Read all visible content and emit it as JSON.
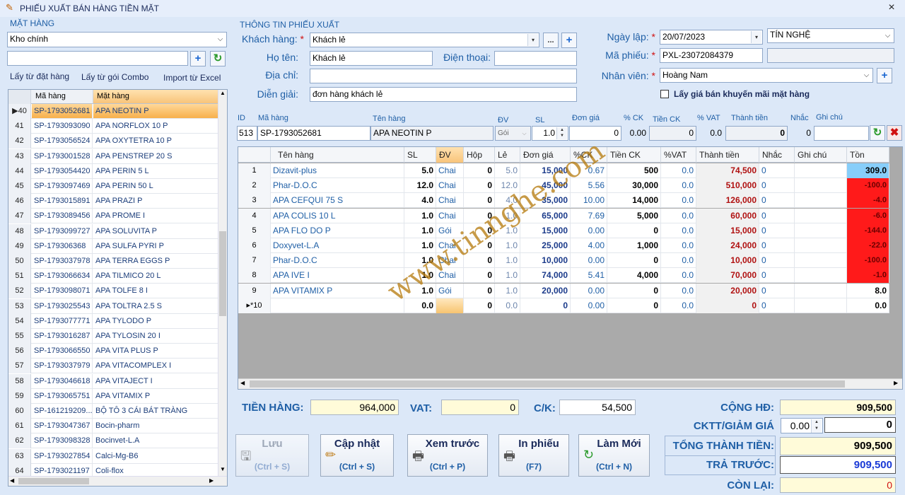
{
  "window": {
    "title": "PHIẾU XUẤT BÁN HÀNG TIỀN MẶT",
    "close": "×"
  },
  "left": {
    "group_title": "MẶT HÀNG",
    "warehouse": "Kho chính",
    "search_value": "",
    "links": [
      "Lấy từ đặt hàng",
      "Lấy từ gói Combo",
      "Import từ Excel"
    ],
    "columns": [
      "Mã hàng",
      "Mặt hàng"
    ],
    "rows": [
      [
        "▶40",
        "SP-1793052681",
        "APA NEOTIN P"
      ],
      [
        "41",
        "SP-1793093090",
        "APA NORFLOX 10 P"
      ],
      [
        "42",
        "SP-1793056524",
        "APA OXYTETRA 10 P"
      ],
      [
        "43",
        "SP-1793001528",
        "APA PENSTREP 20 S"
      ],
      [
        "44",
        "SP-1793054420",
        "APA PERIN 5 L"
      ],
      [
        "45",
        "SP-1793097469",
        "APA PERIN 50 L"
      ],
      [
        "46",
        "SP-1793015891",
        "APA PRAZI P"
      ],
      [
        "47",
        "SP-1793089456",
        "APA PROME I"
      ],
      [
        "48",
        "SP-1793099727",
        "APA SOLUVITA P"
      ],
      [
        "49",
        "SP-179306368",
        "APA SULFA PYRI P"
      ],
      [
        "50",
        "SP-1793037978",
        "APA TERRA EGGS P"
      ],
      [
        "51",
        "SP-1793066634",
        "APA TILMICO 20 L"
      ],
      [
        "52",
        "SP-1793098071",
        "APA TOLFE 8 I"
      ],
      [
        "53",
        "SP-1793025543",
        "APA TOLTRA 2.5 S"
      ],
      [
        "54",
        "SP-1793077771",
        "APA TYLODO P"
      ],
      [
        "55",
        "SP-1793016287",
        "APA TYLOSIN 20 I"
      ],
      [
        "56",
        "SP-1793066550",
        "APA VITA PLUS P"
      ],
      [
        "57",
        "SP-1793037979",
        "APA VITACOMPLEX I"
      ],
      [
        "58",
        "SP-1793046618",
        "APA VITAJECT I"
      ],
      [
        "59",
        "SP-1793065751",
        "APA VITAMIX P"
      ],
      [
        "60",
        "SP-161219209...",
        "BỘ TÔ 3 CÁI BÁT TRÀNG"
      ],
      [
        "61",
        "SP-1793047367",
        "Bocin-pharm"
      ],
      [
        "62",
        "SP-1793098328",
        "Bocinvet-L.A"
      ],
      [
        "63",
        "SP-1793027854",
        "Calci-Mg-B6"
      ],
      [
        "64",
        "SP-1793021197",
        "Coli-flox"
      ]
    ]
  },
  "info": {
    "group_title": "THÔNG TIN PHIẾU XUẤT",
    "customer_label": "Khách hàng:",
    "customer": "Khách lẻ",
    "ellipsis": "...",
    "name_label": "Họ tên:",
    "name": "Khách lẻ",
    "phone_label": "Điện thoại:",
    "phone": "",
    "address_label": "Địa chỉ:",
    "address": "",
    "note_label": "Diễn giải:",
    "note": "đơn hàng khách lẻ",
    "date_label": "Ngày lập:",
    "date": "20/07/2023",
    "store": "TÍN NGHỆ",
    "code_label": "Mã phiếu:",
    "code": "PXL-23072084379",
    "staff_label": "Nhân viên:",
    "staff": "Hoàng Nam",
    "promo_label": "Lấy giá bán khuyến mãi mặt hàng",
    "required": "*"
  },
  "entry": {
    "labels": {
      "id": "ID",
      "code": "Mã hàng",
      "name": "Tên hàng",
      "unit": "ĐV",
      "qty": "SL",
      "price": "Đơn giá",
      "pct_ck": "% CK",
      "ck": "Tiền CK",
      "vat": "% VAT",
      "total": "Thành tiền",
      "remind": "Nhắc",
      "note": "Ghi chú"
    },
    "values": {
      "id": "513",
      "code": "SP-1793052681",
      "name": "APA NEOTIN P",
      "unit": "Gói",
      "qty": "1.0",
      "price": "0",
      "pct_ck": "0.00",
      "ck": "0",
      "vat": "0.0",
      "total": "0",
      "remind": "0",
      "note": ""
    }
  },
  "grid": {
    "columns": [
      "",
      "Tên hàng",
      "SL",
      "ĐV",
      "Hộp",
      "Lẻ",
      "Đơn giá",
      "%CK",
      "Tiền CK",
      "%VAT",
      "Thành tiền",
      "Nhắc",
      "Ghi chú",
      "Tồn"
    ],
    "rows": [
      [
        "1",
        "Dizavit-plus",
        "5.0",
        "Chai",
        "0",
        "5.0",
        "15,000",
        "0.67",
        "500",
        "0.0",
        "74,500",
        "0",
        "",
        "309.0"
      ],
      [
        "2",
        "Phar-D.O.C",
        "12.0",
        "Chai",
        "0",
        "12.0",
        "45,000",
        "5.56",
        "30,000",
        "0.0",
        "510,000",
        "0",
        "",
        "-100.0"
      ],
      [
        "3",
        "APA CEFQUI 75 S",
        "4.0",
        "Chai",
        "0",
        "4.0",
        "35,000",
        "10.00",
        "14,000",
        "0.0",
        "126,000",
        "0",
        "",
        "-4.0"
      ],
      [
        "4",
        "APA COLIS 10 L",
        "1.0",
        "Chai",
        "0",
        "1.0",
        "65,000",
        "7.69",
        "5,000",
        "0.0",
        "60,000",
        "0",
        "",
        "-6.0"
      ],
      [
        "5",
        "APA FLO DO P",
        "1.0",
        "Gói",
        "0",
        "1.0",
        "15,000",
        "0.00",
        "0",
        "0.0",
        "15,000",
        "0",
        "",
        "-144.0"
      ],
      [
        "6",
        "Doxyvet-L.A",
        "1.0",
        "Chai",
        "0",
        "1.0",
        "25,000",
        "4.00",
        "1,000",
        "0.0",
        "24,000",
        "0",
        "",
        "-22.0"
      ],
      [
        "7",
        "Phar-D.O.C",
        "1.0",
        "Chai",
        "0",
        "1.0",
        "10,000",
        "0.00",
        "0",
        "0.0",
        "10,000",
        "0",
        "",
        "-100.0"
      ],
      [
        "8",
        "APA IVE I",
        "1.0",
        "Chai",
        "0",
        "1.0",
        "74,000",
        "5.41",
        "4,000",
        "0.0",
        "70,000",
        "0",
        "",
        "-1.0"
      ],
      [
        "9",
        "APA VITAMIX P",
        "1.0",
        "Gói",
        "0",
        "1.0",
        "20,000",
        "0.00",
        "0",
        "0.0",
        "20,000",
        "0",
        "",
        "8.0"
      ],
      [
        "▸*10",
        "",
        "0.0",
        "",
        "0",
        "0.0",
        "0",
        "0.00",
        "0",
        "0.0",
        "0",
        "0",
        "",
        "0.0"
      ]
    ]
  },
  "totals": {
    "goods_label": "TIỀN HÀNG:",
    "goods": "964,000",
    "vat_label": "VAT:",
    "vat": "0",
    "ck_label": "C/K:",
    "ck": "54,500",
    "sum_label": "CỘNG HĐ:",
    "sum": "909,500",
    "disc_label": "CKTT/GIẢM GIÁ",
    "disc_pct": "0.00",
    "disc": "0",
    "grand_label": "TỔNG THÀNH TIỀN:",
    "grand": "909,500",
    "prepaid_label": "TRẢ TRƯỚC:",
    "prepaid": "909,500",
    "remain_label": "CÒN LẠI:",
    "remain": "0"
  },
  "buttons": [
    {
      "label": "Lưu",
      "key": "(Ctrl + S)"
    },
    {
      "label": "Cập nhật",
      "key": "(Ctrl + S)"
    },
    {
      "label": "Xem trước",
      "key": "(Ctrl + P)"
    },
    {
      "label": "In phiếu",
      "key": "(F7)"
    },
    {
      "label": "Làm Mới",
      "key": "(Ctrl + N)"
    }
  ],
  "watermark": "www.tinnghe.com",
  "colors": {
    "accent": "#1f5fa6",
    "negative_stock": "#ff1a1a",
    "positive_stock": "#87cefa",
    "selected_row": "#f7b04b",
    "total_yellow": "#fffbd9"
  }
}
